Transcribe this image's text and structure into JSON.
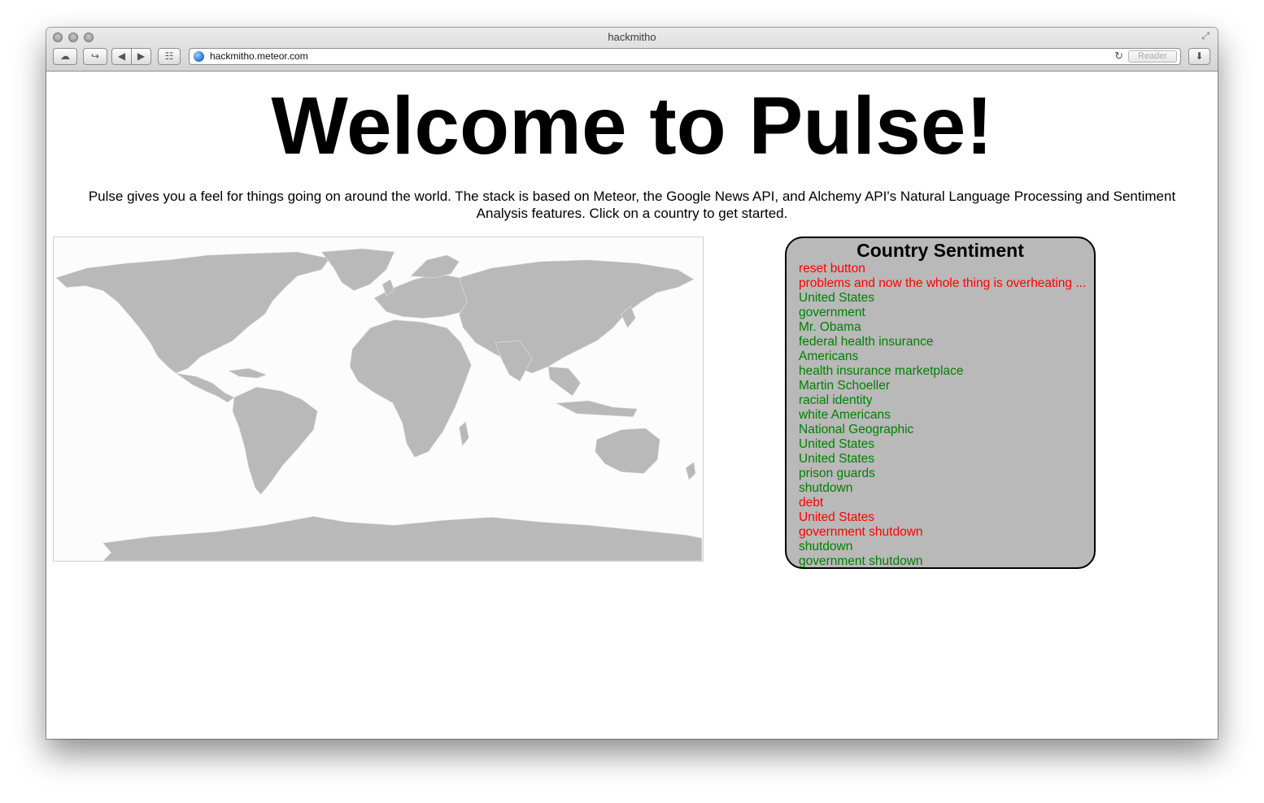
{
  "browser": {
    "window_title": "hackmitho",
    "url": "hackmitho.meteor.com",
    "reader_label": "Reader"
  },
  "page": {
    "heading": "Welcome to Pulse!",
    "intro_line1": "Pulse gives you a feel for things going on around the world. The stack is based on Meteor, the Google News API, and Alchemy API's Natural Language Processing and Sentiment",
    "intro_line2": "Analysis features. Click on a country to get started."
  },
  "panel": {
    "title": "Country Sentiment",
    "items": [
      {
        "text": "reset button",
        "sentiment": "negative"
      },
      {
        "text": "problems and now the whole thing is overheating ...",
        "sentiment": "negative"
      },
      {
        "text": "United States",
        "sentiment": "positive"
      },
      {
        "text": "government",
        "sentiment": "positive"
      },
      {
        "text": "Mr. Obama",
        "sentiment": "positive"
      },
      {
        "text": "federal health insurance",
        "sentiment": "positive"
      },
      {
        "text": "Americans",
        "sentiment": "positive"
      },
      {
        "text": "health insurance marketplace",
        "sentiment": "positive"
      },
      {
        "text": "Martin Schoeller",
        "sentiment": "positive"
      },
      {
        "text": "racial identity",
        "sentiment": "positive"
      },
      {
        "text": "white Americans",
        "sentiment": "positive"
      },
      {
        "text": "National Geographic",
        "sentiment": "positive"
      },
      {
        "text": "United States",
        "sentiment": "positive"
      },
      {
        "text": "United States",
        "sentiment": "positive"
      },
      {
        "text": "prison guards",
        "sentiment": "positive"
      },
      {
        "text": "shutdown",
        "sentiment": "positive"
      },
      {
        "text": "debt",
        "sentiment": "negative"
      },
      {
        "text": "United States",
        "sentiment": "negative"
      },
      {
        "text": "government shutdown",
        "sentiment": "negative"
      },
      {
        "text": "shutdown",
        "sentiment": "positive"
      },
      {
        "text": "government shutdown",
        "sentiment": "positive"
      }
    ]
  },
  "colors": {
    "positive": "#008000",
    "negative": "#ff0000",
    "land": "#b9b9b9",
    "panel_bg": "#b9b9b9"
  },
  "icons": [
    "icloud-icon",
    "share-icon",
    "back-icon",
    "forward-icon",
    "reading-list-icon",
    "globe-icon",
    "reload-icon",
    "downloads-icon",
    "expand-icon"
  ]
}
